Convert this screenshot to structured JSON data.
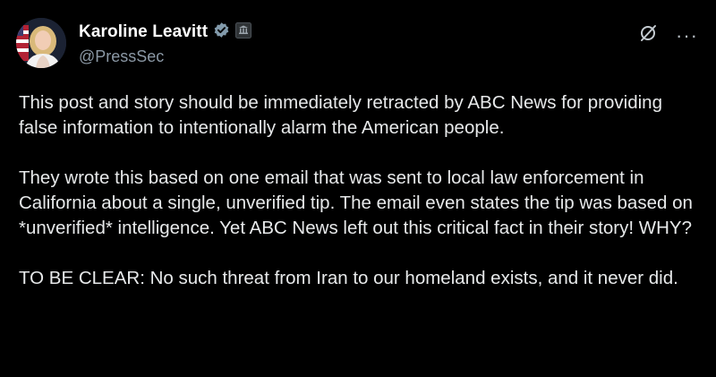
{
  "author": {
    "display_name": "Karoline Leavitt",
    "handle": "@PressSec",
    "verified": true,
    "avatar": "avatar-photo"
  },
  "icons": {
    "verified": "verified-badge-icon",
    "affiliate": "government-affiliate-badge",
    "grok": "grok-slash-icon",
    "more": "more-horizontal-icon"
  },
  "colors": {
    "background": "#000000",
    "text": "#e7e9ea",
    "muted": "#8b98a5",
    "verified_badge": "#829aab"
  },
  "more_label": "···",
  "post": {
    "paragraphs": [
      "This post and story should be immediately retracted by ABC News for providing false information to intentionally alarm the American people.",
      "They wrote this based on one email that was sent to local law enforcement in California about a single, unverified tip. The email even states the tip was based on *unverified* intelligence. Yet ABC News left out this critical fact in their story! WHY?",
      "TO BE CLEAR: No such threat from Iran to our homeland exists, and it never did."
    ]
  }
}
